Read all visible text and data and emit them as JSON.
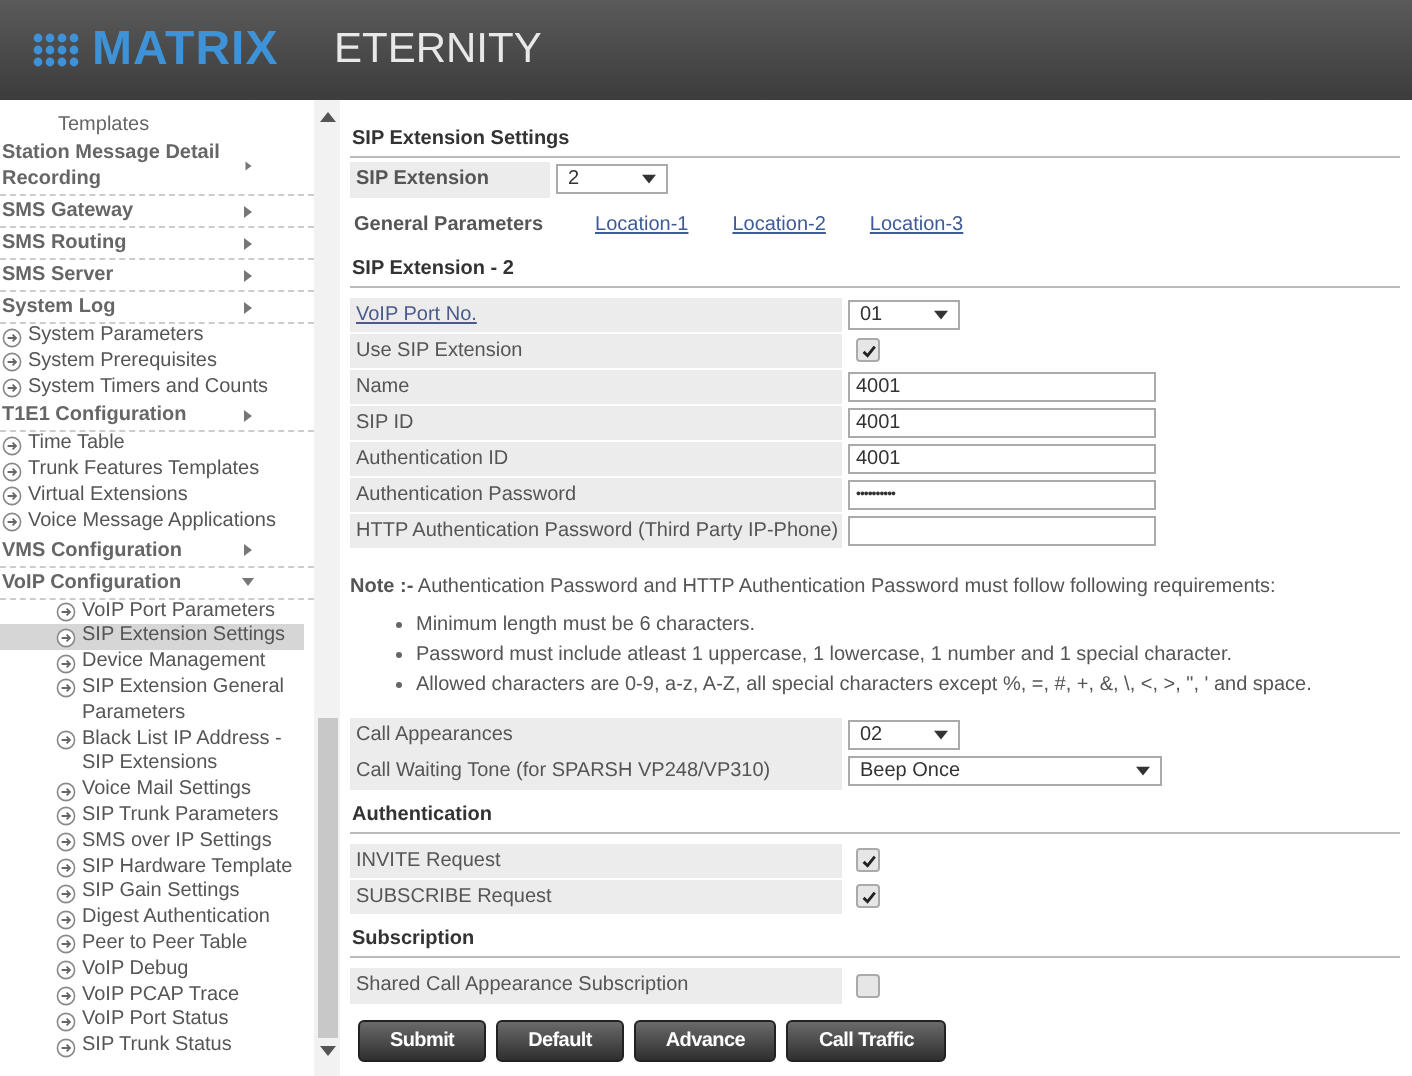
{
  "header": {
    "logo": "MATRIX",
    "product": "ETERNITY"
  },
  "sidebar": {
    "items": [
      {
        "kind": "continuation",
        "label": "Templates"
      },
      {
        "kind": "menu",
        "label": "Station Message Detail Recording",
        "expanded": false
      },
      {
        "kind": "menu",
        "label": "SMS Gateway",
        "expanded": false
      },
      {
        "kind": "menu",
        "label": "SMS Routing",
        "expanded": false
      },
      {
        "kind": "menu",
        "label": "SMS Server",
        "expanded": false
      },
      {
        "kind": "menu",
        "label": "System Log",
        "expanded": false
      },
      {
        "kind": "page",
        "label": "System Parameters",
        "selected": false
      },
      {
        "kind": "page",
        "label": "System Prerequisites",
        "selected": false
      },
      {
        "kind": "page",
        "label": "System Timers and Counts",
        "selected": false
      },
      {
        "kind": "menu",
        "label": "T1E1 Configuration",
        "expanded": false
      },
      {
        "kind": "page",
        "label": "Time Table",
        "selected": false
      },
      {
        "kind": "page",
        "label": "Trunk Features Templates",
        "selected": false
      },
      {
        "kind": "page",
        "label": "Virtual Extensions",
        "selected": false
      },
      {
        "kind": "page",
        "label": "Voice Message Applications",
        "selected": false
      },
      {
        "kind": "menu",
        "label": "VMS Configuration",
        "expanded": false
      },
      {
        "kind": "menu",
        "label": "VoIP Configuration",
        "expanded": true,
        "children": [
          {
            "label": "VoIP Port Parameters",
            "selected": false
          },
          {
            "label": "SIP Extension Settings",
            "selected": true
          },
          {
            "label": "Device Management",
            "selected": false
          },
          {
            "label": "SIP Extension General Parameters",
            "selected": false
          },
          {
            "label": "Black List IP Address - SIP Extensions",
            "selected": false
          },
          {
            "label": "Voice Mail Settings",
            "selected": false
          },
          {
            "label": "SIP Trunk Parameters",
            "selected": false
          },
          {
            "label": "SMS over IP Settings",
            "selected": false
          },
          {
            "label": "SIP Hardware Template",
            "selected": false
          },
          {
            "label": "SIP Gain Settings",
            "selected": false
          },
          {
            "label": "Digest Authentication",
            "selected": false
          },
          {
            "label": "Peer to Peer Table",
            "selected": false
          },
          {
            "label": "VoIP Debug",
            "selected": false
          },
          {
            "label": "VoIP PCAP Trace",
            "selected": false
          },
          {
            "label": "VoIP Port Status",
            "selected": false
          },
          {
            "label": "SIP Trunk Status",
            "selected": false
          }
        ]
      }
    ]
  },
  "page_title": "SIP Extension Settings",
  "extension_select": {
    "label": "SIP Extension",
    "value": "2"
  },
  "parameter_tabs": [
    {
      "label": "General Parameters",
      "selected": true
    },
    {
      "label": "Location-1",
      "selected": false
    },
    {
      "label": "Location-2",
      "selected": false
    },
    {
      "label": "Location-3",
      "selected": false
    }
  ],
  "blocks": [
    {
      "kind": "heading",
      "title": "SIP Extension - 2"
    },
    {
      "kind": "fields",
      "rows": [
        {
          "kind": "select",
          "label": "VoIP Port No.",
          "link": true,
          "value": "01"
        },
        {
          "kind": "checkbox",
          "label": "Use SIP Extension",
          "link": false,
          "checked": true
        },
        {
          "kind": "text",
          "label": "Name",
          "link": false,
          "value": "4001"
        },
        {
          "kind": "text",
          "label": "SIP ID",
          "link": false,
          "value": "4001"
        },
        {
          "kind": "text",
          "label": "Authentication ID",
          "link": false,
          "value": "4001"
        },
        {
          "kind": "password",
          "label": "Authentication Password",
          "link": false,
          "value": "••••••••••"
        },
        {
          "kind": "text",
          "label": "HTTP Authentication Password (Third Party IP-Phone)",
          "link": false,
          "value": ""
        }
      ]
    },
    {
      "kind": "note",
      "text": "**Note :-** Authentication Password and HTTP Authentication Password must follow following requirements:",
      "bullets": [
        "Minimum length must be 6 characters.",
        "Password must include atleast 1 uppercase, 1 lowercase, 1 number and 1 special character.",
        "Allowed characters are 0-9, a-z, A-Z, all special characters except %, =, #, +, &, \\, <, >, \", ' and space."
      ]
    },
    {
      "kind": "fields",
      "rows": [
        {
          "kind": "select",
          "label": "Call Appearances",
          "link": false,
          "value": "02"
        },
        {
          "kind": "wide-select",
          "label": "Call Waiting Tone (for SPARSH VP248/VP310)",
          "link": false,
          "value": "Beep Once"
        }
      ]
    },
    {
      "kind": "heading",
      "title": "Authentication"
    },
    {
      "kind": "fields",
      "rows": [
        {
          "kind": "checkbox",
          "label": "INVITE Request",
          "link": false,
          "checked": true
        },
        {
          "kind": "checkbox",
          "label": "SUBSCRIBE Request",
          "link": false,
          "checked": true
        }
      ]
    },
    {
      "kind": "heading",
      "title": "Subscription"
    },
    {
      "kind": "fields",
      "rows": [
        {
          "kind": "checkbox",
          "label": "Shared Call Appearance Subscription",
          "link": false,
          "checked": false
        }
      ]
    }
  ],
  "buttons": [
    "Submit",
    "Default",
    "Advance",
    "Call Traffic"
  ]
}
